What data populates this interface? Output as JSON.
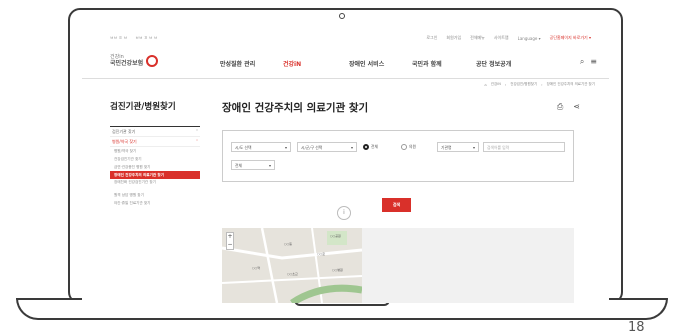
{
  "util_bar": {
    "left": [
      "ㅂㅂ ㅍ ㅂ",
      "ㅂㅂ ㅍ ㅂ ㅂ"
    ],
    "right": [
      "로그인",
      "회원가입",
      "전체메뉴",
      "사이트맵",
      "Language ▾"
    ],
    "highlight": "공단홈페이지 바로가기 ▾"
  },
  "logo": {
    "small": "건강in",
    "name": "국민건강보험"
  },
  "gnb": {
    "menu": [
      "만성질환 관리",
      "건강iN",
      "장애인 서비스",
      "국민과 함께",
      "공단 정보공개"
    ],
    "search_icon": "search-icon",
    "menu_icon": "hamburger-icon"
  },
  "breadcrumb": [
    "홈",
    "건강iN",
    "건강검진/병원찾기",
    "장애인 건강주치의 의료기관 찾기"
  ],
  "sidebar": {
    "title": "검진기관/병원찾기",
    "items": [
      {
        "label": "검진기관 찾기",
        "open": false
      },
      {
        "label": "병원/약국 찾기",
        "open": true
      }
    ],
    "subs": [
      "병원/약국 찾기",
      "건강검진기관 찾기",
      "금연·건강증진 병원 찾기",
      "장애인 건강주치의 의료기관 찾기",
      "장애친화 건강검진기관 찾기",
      "원격 상담 병원 찾기",
      "야간·휴일 진료기관 찾기"
    ],
    "active_index": 3
  },
  "page": {
    "title": "장애인 건강주치의 의료기관 찾기",
    "print_icon": "print-icon",
    "share_icon": "share-icon"
  },
  "search_form": {
    "sido": "시/도 선택",
    "sigungu": "시/군/구 선택",
    "radio_all": "전체",
    "radio_clinic": "의원",
    "field": "기관명",
    "keyword_placeholder": "검색어를 입력",
    "type": "전체",
    "button": "검색"
  },
  "map": {
    "zoom_in": "+",
    "zoom_out": "−",
    "labels": [
      "○○동",
      "○○로",
      "○○역",
      "○○공원",
      "○○초교",
      "○○병원"
    ]
  },
  "laptop": {
    "page_number": "18"
  }
}
